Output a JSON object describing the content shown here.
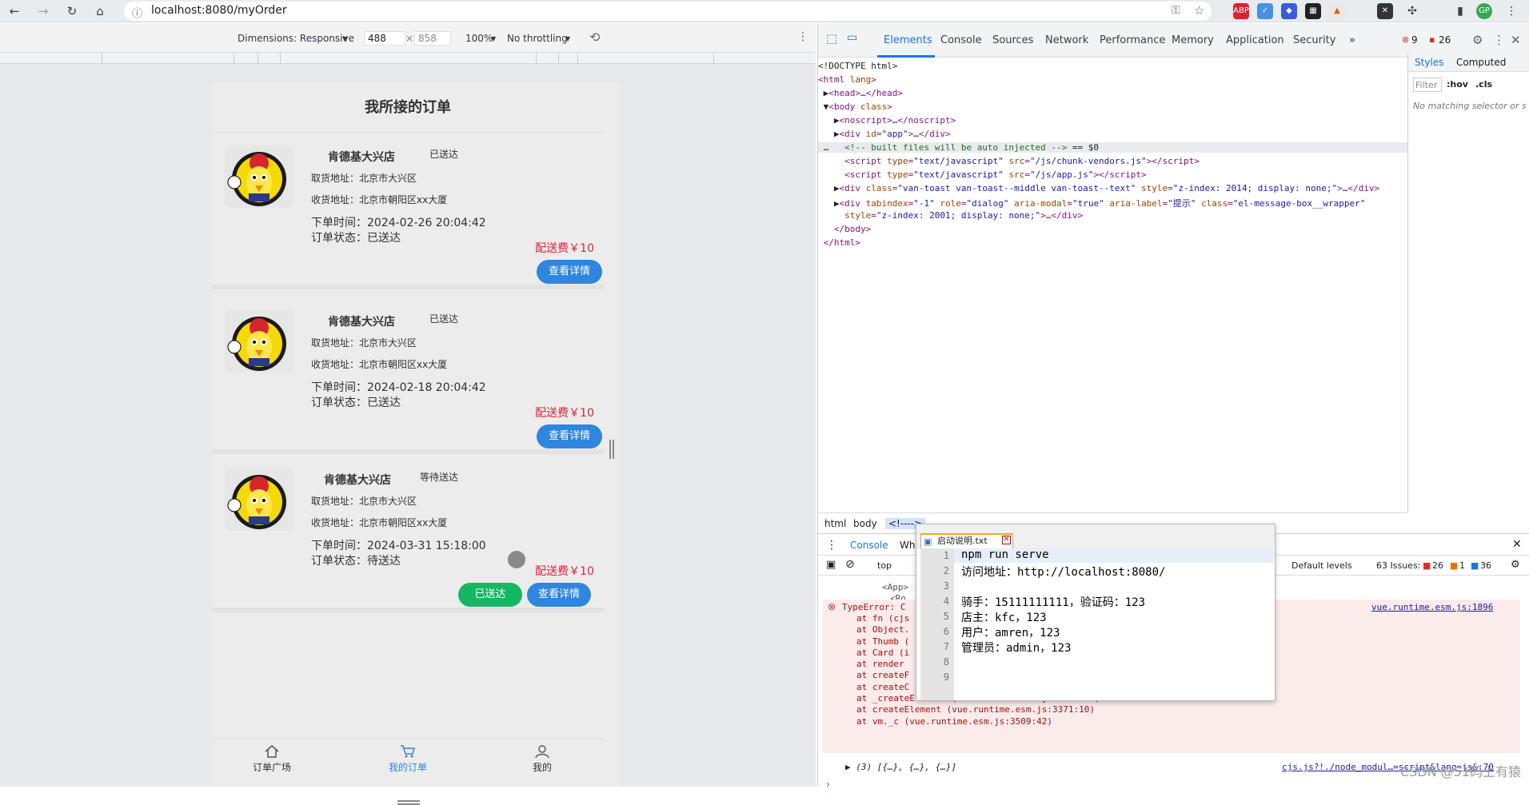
{
  "browser": {
    "url": "localhost:8080/myOrder",
    "ext_abp": "ABP",
    "profile": "GP"
  },
  "device_toolbar": {
    "dimensions": "Dimensions: Responsive",
    "width": "488",
    "x": "×",
    "height": "858",
    "zoom": "100%",
    "throttle": "No throttling"
  },
  "app": {
    "title": "我所接的订单",
    "orders": [
      {
        "shop": "肯德基大兴店",
        "status_tag": "已送达",
        "pickup": "取货地址：北京市大兴区",
        "delivery": "收货地址：北京市朝阳区xx大厦",
        "time": "下单时间：2024-02-26 20:04:42",
        "status": "订单状态：已送达",
        "fee": "配送费￥10",
        "detail_btn": "查看详情"
      },
      {
        "shop": "肯德基大兴店",
        "status_tag": "已送达",
        "pickup": "取货地址：北京市大兴区",
        "delivery": "收货地址：北京市朝阳区xx大厦",
        "time": "下单时间：2024-02-18 20:04:42",
        "status": "订单状态：已送达",
        "fee": "配送费￥10",
        "detail_btn": "查看详情"
      },
      {
        "shop": "肯德基大兴店",
        "status_tag": "等待送达",
        "pickup": "取货地址：北京市大兴区",
        "delivery": "收货地址：北京市朝阳区xx大厦",
        "time": "下单时间：2024-03-31 15:18:00",
        "status": "订单状态：待送达",
        "fee": "配送费￥10",
        "delivered_btn": "已送达",
        "detail_btn": "查看详情"
      }
    ],
    "tabs": [
      "订单广场",
      "我的订单",
      "我的"
    ]
  },
  "devtools": {
    "tabs": [
      "Elements",
      "Console",
      "Sources",
      "Network",
      "Performance",
      "Memory",
      "Application",
      "Security"
    ],
    "errors": "9",
    "warnings": "26",
    "styles_tabs": [
      "Styles",
      "Computed"
    ],
    "filter": "Filter",
    "hov": ":hov",
    "cls": ".cls",
    "no_match": "No matching selector or s",
    "breadcrumbs": [
      "html",
      "body",
      "<!---->"
    ],
    "console_tab": "Console",
    "console_tab2": "Wha",
    "context": "top",
    "levels": "Default levels",
    "issues_label": "63 Issues:",
    "issues_err": "26",
    "issues_warn": "1",
    "issues_info": "36",
    "error_text": "TypeError: C",
    "error_src": "vue.runtime.esm.js:1896",
    "stack": [
      "at fn (cjs",
      "at Object.",
      "at Thumb (",
      "at Card (i",
      "at render",
      "at createF",
      "at createC",
      "at _createElement (vue.runtime.esm.js:3440:15)",
      "at createElement (vue.runtime.esm.js:3371:10)",
      "at vm._c (vue.runtime.esm.js:3509:42)"
    ],
    "app_frag1": "<App>",
    "app_frag2": "<Ro",
    "log_line": "▶ (3) [{…}, {…}, {…}]",
    "log_src": "cjs.js?!./node_modul…=script&lang=js&:70"
  },
  "notepad": {
    "tab": "启动说明.txt",
    "lines": [
      "npm run serve",
      "访问地址：http://localhost:8080/",
      "",
      "骑手：15111111111，验证码：123",
      "店主：kfc，123",
      "用户：amren，123",
      "管理员：admin，123",
      "",
      ""
    ]
  },
  "watermark": "CSDN @51码上有猿"
}
